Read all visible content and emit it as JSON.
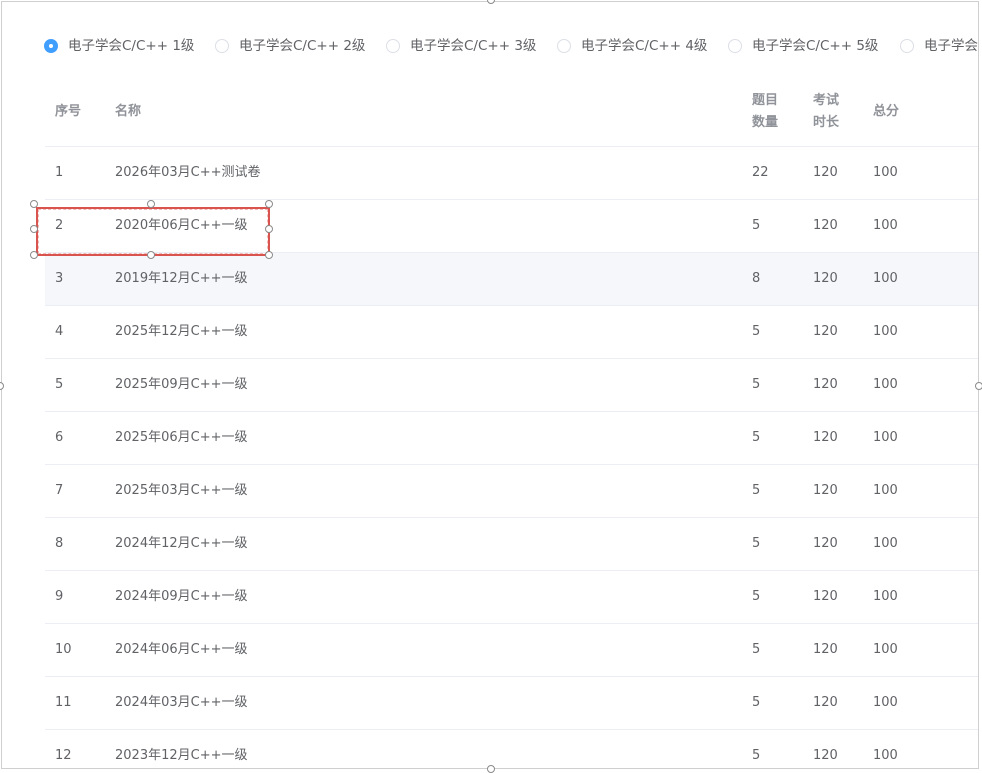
{
  "levels": [
    {
      "label": "电子学会C/C++ 1级",
      "checked": true
    },
    {
      "label": "电子学会C/C++ 2级",
      "checked": false
    },
    {
      "label": "电子学会C/C++ 3级",
      "checked": false
    },
    {
      "label": "电子学会C/C++ 4级",
      "checked": false
    },
    {
      "label": "电子学会C/C++ 5级",
      "checked": false
    },
    {
      "label": "电子学会C",
      "checked": false
    }
  ],
  "table": {
    "headers": {
      "idx": "序号",
      "name": "名称",
      "count_1": "题目",
      "count_2": "数量",
      "duration_1": "考试",
      "duration_2": "时长",
      "score": "总分"
    },
    "rows": [
      {
        "idx": "1",
        "name": "2026年03月C++测试卷",
        "count": "22",
        "duration": "120",
        "score": "100"
      },
      {
        "idx": "2",
        "name": "2020年06月C++一级",
        "count": "5",
        "duration": "120",
        "score": "100"
      },
      {
        "idx": "3",
        "name": "2019年12月C++一级",
        "count": "8",
        "duration": "120",
        "score": "100"
      },
      {
        "idx": "4",
        "name": "2025年12月C++一级",
        "count": "5",
        "duration": "120",
        "score": "100"
      },
      {
        "idx": "5",
        "name": "2025年09月C++一级",
        "count": "5",
        "duration": "120",
        "score": "100"
      },
      {
        "idx": "6",
        "name": "2025年06月C++一级",
        "count": "5",
        "duration": "120",
        "score": "100"
      },
      {
        "idx": "7",
        "name": "2025年03月C++一级",
        "count": "5",
        "duration": "120",
        "score": "100"
      },
      {
        "idx": "8",
        "name": "2024年12月C++一级",
        "count": "5",
        "duration": "120",
        "score": "100"
      },
      {
        "idx": "9",
        "name": "2024年09月C++一级",
        "count": "5",
        "duration": "120",
        "score": "100"
      },
      {
        "idx": "10",
        "name": "2024年06月C++一级",
        "count": "5",
        "duration": "120",
        "score": "100"
      },
      {
        "idx": "11",
        "name": "2024年03月C++一级",
        "count": "5",
        "duration": "120",
        "score": "100"
      },
      {
        "idx": "12",
        "name": "2023年12月C++一级",
        "count": "5",
        "duration": "120",
        "score": "100"
      }
    ]
  },
  "colors": {
    "accent": "#409eff",
    "selection": "#d9534f",
    "hover_row": "#f5f7fa"
  }
}
